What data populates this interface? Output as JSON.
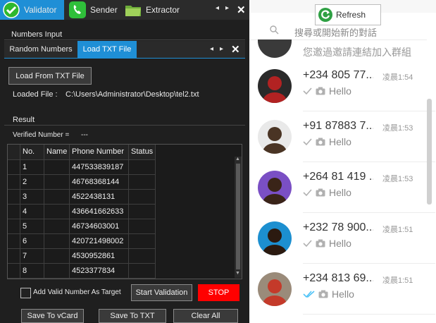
{
  "tabs": [
    {
      "label": "Validator",
      "active": true
    },
    {
      "label": "Sender",
      "active": false
    },
    {
      "label": "Extractor",
      "active": false
    }
  ],
  "nav": {
    "prev": "◂",
    "next": "▸",
    "close": "✕"
  },
  "numbers_input": {
    "title": "Numbers Input",
    "subtabs": [
      "Random Numbers",
      "Load TXT File"
    ],
    "load_button": "Load From TXT File",
    "loaded_label": "Loaded File :",
    "loaded_path": "C:\\Users\\Administrator\\Desktop\\tel2.txt"
  },
  "result": {
    "title": "Result",
    "verified_label": "Verified Number =",
    "verified_value": "---",
    "columns": [
      "No.",
      "Name",
      "Phone Number",
      "Status"
    ],
    "rows": [
      {
        "no": "1",
        "name": "",
        "phone": "447533839187",
        "status": ""
      },
      {
        "no": "2",
        "name": "",
        "phone": "46768368144",
        "status": ""
      },
      {
        "no": "3",
        "name": "",
        "phone": "4522438131",
        "status": ""
      },
      {
        "no": "4",
        "name": "",
        "phone": "436641662633",
        "status": ""
      },
      {
        "no": "5",
        "name": "",
        "phone": "46734603001",
        "status": ""
      },
      {
        "no": "6",
        "name": "",
        "phone": "420721498002",
        "status": ""
      },
      {
        "no": "7",
        "name": "",
        "phone": "4530952861",
        "status": ""
      },
      {
        "no": "8",
        "name": "",
        "phone": "4523377834",
        "status": ""
      }
    ]
  },
  "controls": {
    "add_valid_label": "Add Valid Number As Target",
    "start_button": "Start Validation",
    "stop_button": "STOP",
    "save_vcard": "Save To vCard",
    "save_txt": "Save To TXT",
    "clear_all": "Clear All"
  },
  "chat": {
    "refresh_label": "Refresh",
    "search_placeholder": "搜尋或開始新的對話",
    "partial_top_text": "您邀過邀請連結加入群組",
    "items": [
      {
        "name": "+234 805 77...",
        "time": "凌晨1:54",
        "message": "Hello",
        "tick": "single"
      },
      {
        "name": "+91 87883 7...",
        "time": "凌晨1:53",
        "message": "Hello",
        "tick": "single"
      },
      {
        "name": "+264 81 419 ...",
        "time": "凌晨1:53",
        "message": "Hello",
        "tick": "single"
      },
      {
        "name": "+232 78 900...",
        "time": "凌晨1:51",
        "message": "Hello",
        "tick": "single"
      },
      {
        "name": "+234 813 69...",
        "time": "凌晨1:51",
        "message": "Hello",
        "tick": "double-blue"
      }
    ]
  },
  "colors": {
    "accent": "#1f8fd6",
    "stop": "#ff0000",
    "read_tick": "#4fc3f7"
  }
}
